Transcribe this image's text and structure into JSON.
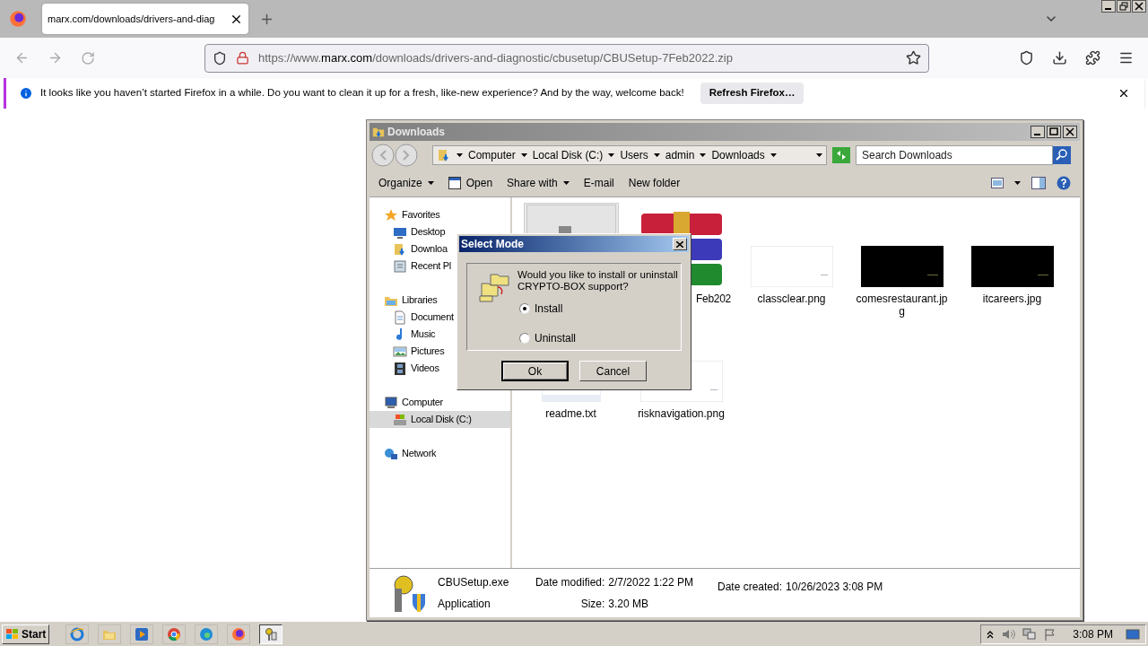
{
  "browser": {
    "tab_title": "marx.com/downloads/drivers-and-diag",
    "url_prefix": "https://www.",
    "url_domain": "marx.com",
    "url_path": "/downloads/drivers-and-diagnostic/cbusetup/CBUSetup-7Feb2022.zip"
  },
  "notification": {
    "message": "It looks like you haven’t started Firefox in a while. Do you want to clean it up for a fresh, like-new experience? And by the way, welcome back!",
    "button": "Refresh Firefox…"
  },
  "explorer": {
    "title": "Downloads",
    "breadcrumb": [
      "Computer",
      "Local Disk (C:)",
      "Users",
      "admin",
      "Downloads"
    ],
    "search_placeholder": "Search Downloads",
    "toolbar": [
      {
        "label": "Organize",
        "kind": "menu"
      },
      {
        "label": "Open",
        "kind": "open"
      },
      {
        "label": "Share with",
        "kind": "menu"
      },
      {
        "label": "E-mail",
        "kind": "plain"
      },
      {
        "label": "New folder",
        "kind": "plain"
      }
    ],
    "nav": [
      {
        "label": "Favorites",
        "kind": "star",
        "selected": false,
        "children": [
          {
            "label": "Desktop",
            "kind": "desktop",
            "selected": false
          },
          {
            "label": "Downloa",
            "kind": "downloads",
            "selected": false
          },
          {
            "label": "Recent Pl",
            "kind": "recent",
            "selected": false
          }
        ]
      },
      {
        "label": "Libraries",
        "kind": "libraries",
        "selected": false,
        "children": [
          {
            "label": "Document",
            "kind": "documents",
            "selected": false
          },
          {
            "label": "Music",
            "kind": "music",
            "selected": false
          },
          {
            "label": "Pictures",
            "kind": "pictures",
            "selected": false
          },
          {
            "label": "Videos",
            "kind": "videos",
            "selected": false
          }
        ]
      },
      {
        "label": "Computer",
        "kind": "computer",
        "selected": false,
        "children": [
          {
            "label": "Local Disk (C:)",
            "kind": "disk",
            "selected": true
          }
        ]
      },
      {
        "label": "Network",
        "kind": "network",
        "selected": false
      }
    ],
    "files": [
      {
        "kind": "exe",
        "selected": true
      },
      {
        "name": "Feb202",
        "kind": "archive",
        "selected": false
      },
      {
        "name": "classclear.png",
        "kind": "image_light",
        "selected": false
      },
      {
        "name": "comesrestaurant.jp",
        "name_2": "g",
        "kind": "image_dark",
        "selected": false
      },
      {
        "name": "itcareers.jpg",
        "kind": "image_dark",
        "selected": false
      },
      {
        "name": "readme.txt",
        "kind": "text",
        "selected": false
      },
      {
        "name": "risknavigation.png",
        "kind": "image_light",
        "selected": false
      }
    ],
    "details": {
      "name": "CBUSetup.exe",
      "type": "Application",
      "modified_label": "Date modified:",
      "modified": "2/7/2022 1:22 PM",
      "size_label": "Size:",
      "size": "3.20 MB",
      "created_label": "Date created:",
      "created": "10/26/2023 3:08 PM"
    }
  },
  "dialog": {
    "title": "Select Mode",
    "question": "Would you like to install or uninstall CRYPTO-BOX support?",
    "options": [
      {
        "label": "Install",
        "selected": true
      },
      {
        "label": "Uninstall",
        "selected": false
      }
    ],
    "ok": "Ok",
    "cancel": "Cancel"
  },
  "taskbar": {
    "start": "Start",
    "apps": [
      {
        "kind": "ie",
        "selected": false
      },
      {
        "kind": "folder",
        "selected": false
      },
      {
        "kind": "media",
        "selected": false
      },
      {
        "kind": "chrome",
        "selected": false
      },
      {
        "kind": "edge",
        "selected": false
      },
      {
        "kind": "firefox",
        "selected": false
      },
      {
        "kind": "keys",
        "selected": true
      }
    ],
    "clock": "3:08 PM"
  }
}
